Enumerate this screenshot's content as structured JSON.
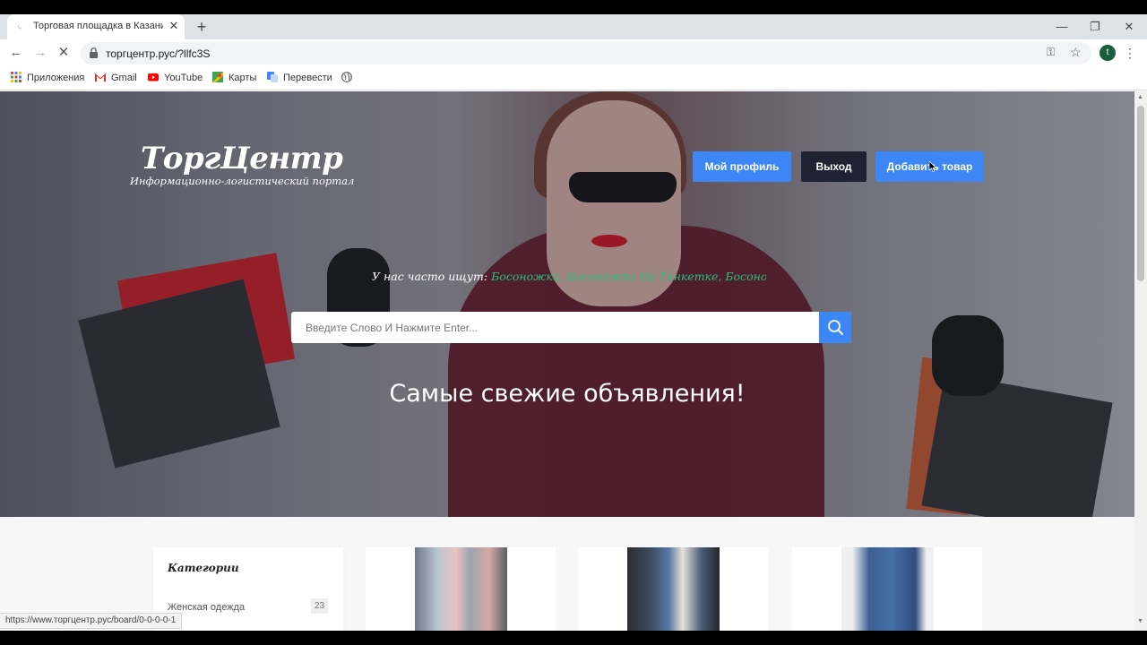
{
  "browser": {
    "tab_title": "Торговая площадка в Казани | Т",
    "tab_close": "✕",
    "new_tab": "+",
    "window_controls": {
      "minimize": "—",
      "maximize": "❐",
      "close": "✕"
    },
    "nav": {
      "back": "←",
      "forward": "→",
      "reload": "✕"
    },
    "url": "торгцентр.рус/?llfc3S",
    "profile_initial": "t",
    "menu": "⋮",
    "bookmarks": [
      {
        "label": "Приложения",
        "icon": "apps-grid-icon"
      },
      {
        "label": "Gmail",
        "icon": "gmail-icon"
      },
      {
        "label": "YouTube",
        "icon": "youtube-icon"
      },
      {
        "label": "Карты",
        "icon": "maps-icon"
      },
      {
        "label": "Перевести",
        "icon": "translate-icon"
      }
    ],
    "status_url": "https://www.торгцентр.рус/board/0-0-0-0-1"
  },
  "site": {
    "logo_main": "ТоргЦентр",
    "logo_sub": "Информационно-логистический портал",
    "buttons": {
      "profile": "Мой профиль",
      "logout": "Выход",
      "add_item": "Добавить товар"
    },
    "often_label": "У нас часто ищут:",
    "often_tags": " Босоножки, Босоножки На Танкетке, Босоножки На Платформе",
    "search_placeholder": "Введите Слово И Нажмите Enter...",
    "headline": "Самые свежие объявления!",
    "categories": {
      "title": "Категории",
      "items": [
        {
          "label": "Женская одежда",
          "count": "23"
        }
      ]
    }
  },
  "colors": {
    "accent_blue": "#3d86f5",
    "dark_button": "#1f2233",
    "tag_green": "#27c27a"
  }
}
